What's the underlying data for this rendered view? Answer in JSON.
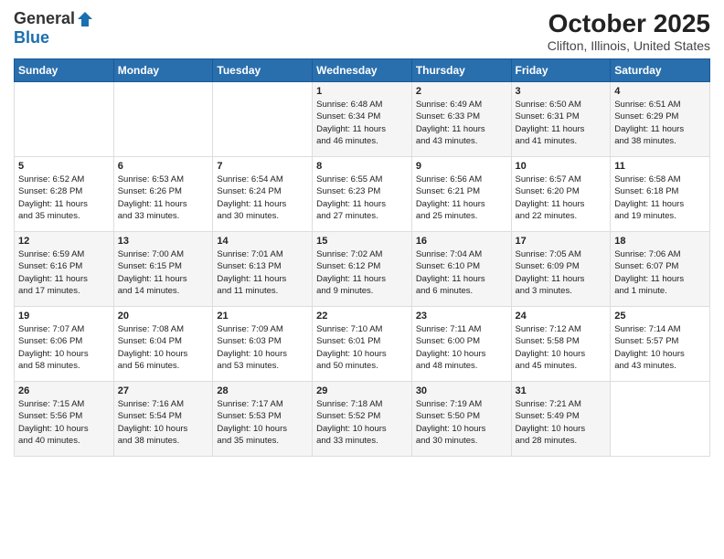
{
  "header": {
    "logo_general": "General",
    "logo_blue": "Blue",
    "title": "October 2025",
    "subtitle": "Clifton, Illinois, United States"
  },
  "weekdays": [
    "Sunday",
    "Monday",
    "Tuesday",
    "Wednesday",
    "Thursday",
    "Friday",
    "Saturday"
  ],
  "weeks": [
    [
      {
        "num": "",
        "info": ""
      },
      {
        "num": "",
        "info": ""
      },
      {
        "num": "",
        "info": ""
      },
      {
        "num": "1",
        "info": "Sunrise: 6:48 AM\nSunset: 6:34 PM\nDaylight: 11 hours\nand 46 minutes."
      },
      {
        "num": "2",
        "info": "Sunrise: 6:49 AM\nSunset: 6:33 PM\nDaylight: 11 hours\nand 43 minutes."
      },
      {
        "num": "3",
        "info": "Sunrise: 6:50 AM\nSunset: 6:31 PM\nDaylight: 11 hours\nand 41 minutes."
      },
      {
        "num": "4",
        "info": "Sunrise: 6:51 AM\nSunset: 6:29 PM\nDaylight: 11 hours\nand 38 minutes."
      }
    ],
    [
      {
        "num": "5",
        "info": "Sunrise: 6:52 AM\nSunset: 6:28 PM\nDaylight: 11 hours\nand 35 minutes."
      },
      {
        "num": "6",
        "info": "Sunrise: 6:53 AM\nSunset: 6:26 PM\nDaylight: 11 hours\nand 33 minutes."
      },
      {
        "num": "7",
        "info": "Sunrise: 6:54 AM\nSunset: 6:24 PM\nDaylight: 11 hours\nand 30 minutes."
      },
      {
        "num": "8",
        "info": "Sunrise: 6:55 AM\nSunset: 6:23 PM\nDaylight: 11 hours\nand 27 minutes."
      },
      {
        "num": "9",
        "info": "Sunrise: 6:56 AM\nSunset: 6:21 PM\nDaylight: 11 hours\nand 25 minutes."
      },
      {
        "num": "10",
        "info": "Sunrise: 6:57 AM\nSunset: 6:20 PM\nDaylight: 11 hours\nand 22 minutes."
      },
      {
        "num": "11",
        "info": "Sunrise: 6:58 AM\nSunset: 6:18 PM\nDaylight: 11 hours\nand 19 minutes."
      }
    ],
    [
      {
        "num": "12",
        "info": "Sunrise: 6:59 AM\nSunset: 6:16 PM\nDaylight: 11 hours\nand 17 minutes."
      },
      {
        "num": "13",
        "info": "Sunrise: 7:00 AM\nSunset: 6:15 PM\nDaylight: 11 hours\nand 14 minutes."
      },
      {
        "num": "14",
        "info": "Sunrise: 7:01 AM\nSunset: 6:13 PM\nDaylight: 11 hours\nand 11 minutes."
      },
      {
        "num": "15",
        "info": "Sunrise: 7:02 AM\nSunset: 6:12 PM\nDaylight: 11 hours\nand 9 minutes."
      },
      {
        "num": "16",
        "info": "Sunrise: 7:04 AM\nSunset: 6:10 PM\nDaylight: 11 hours\nand 6 minutes."
      },
      {
        "num": "17",
        "info": "Sunrise: 7:05 AM\nSunset: 6:09 PM\nDaylight: 11 hours\nand 3 minutes."
      },
      {
        "num": "18",
        "info": "Sunrise: 7:06 AM\nSunset: 6:07 PM\nDaylight: 11 hours\nand 1 minute."
      }
    ],
    [
      {
        "num": "19",
        "info": "Sunrise: 7:07 AM\nSunset: 6:06 PM\nDaylight: 10 hours\nand 58 minutes."
      },
      {
        "num": "20",
        "info": "Sunrise: 7:08 AM\nSunset: 6:04 PM\nDaylight: 10 hours\nand 56 minutes."
      },
      {
        "num": "21",
        "info": "Sunrise: 7:09 AM\nSunset: 6:03 PM\nDaylight: 10 hours\nand 53 minutes."
      },
      {
        "num": "22",
        "info": "Sunrise: 7:10 AM\nSunset: 6:01 PM\nDaylight: 10 hours\nand 50 minutes."
      },
      {
        "num": "23",
        "info": "Sunrise: 7:11 AM\nSunset: 6:00 PM\nDaylight: 10 hours\nand 48 minutes."
      },
      {
        "num": "24",
        "info": "Sunrise: 7:12 AM\nSunset: 5:58 PM\nDaylight: 10 hours\nand 45 minutes."
      },
      {
        "num": "25",
        "info": "Sunrise: 7:14 AM\nSunset: 5:57 PM\nDaylight: 10 hours\nand 43 minutes."
      }
    ],
    [
      {
        "num": "26",
        "info": "Sunrise: 7:15 AM\nSunset: 5:56 PM\nDaylight: 10 hours\nand 40 minutes."
      },
      {
        "num": "27",
        "info": "Sunrise: 7:16 AM\nSunset: 5:54 PM\nDaylight: 10 hours\nand 38 minutes."
      },
      {
        "num": "28",
        "info": "Sunrise: 7:17 AM\nSunset: 5:53 PM\nDaylight: 10 hours\nand 35 minutes."
      },
      {
        "num": "29",
        "info": "Sunrise: 7:18 AM\nSunset: 5:52 PM\nDaylight: 10 hours\nand 33 minutes."
      },
      {
        "num": "30",
        "info": "Sunrise: 7:19 AM\nSunset: 5:50 PM\nDaylight: 10 hours\nand 30 minutes."
      },
      {
        "num": "31",
        "info": "Sunrise: 7:21 AM\nSunset: 5:49 PM\nDaylight: 10 hours\nand 28 minutes."
      },
      {
        "num": "",
        "info": ""
      }
    ]
  ]
}
